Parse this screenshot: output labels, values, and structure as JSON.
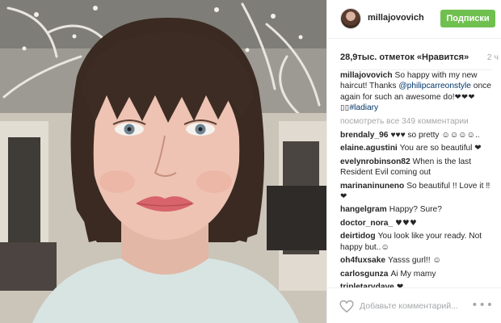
{
  "post": {
    "username": "millajovovich",
    "follow_label": "Подписки",
    "likes": "28,9тыс. отметок «Нравится»",
    "time": "2 ч",
    "caption": {
      "user": "millajovovich",
      "text_1": "So happy with my new haircut! Thanks",
      "mention": "@philipcarreonstyle",
      "text_2": "once again for such an awesome do!",
      "hearts": "❤❤❤",
      "tag_prefix": "▯▯",
      "hashtag": "#ladiary"
    },
    "view_all": "посмотреть все 349 комментарии",
    "comments": [
      {
        "user": "brendaly_96",
        "text": "♥♥♥ so pretty ☺☺☺☺.."
      },
      {
        "user": "elaine.agustini",
        "text": "You are so beautiful ❤"
      },
      {
        "user": "evelynrobinson82",
        "text": "When is the last Resident Evil coming out"
      },
      {
        "user": "marinaninuneno",
        "text": "So beautiful !! Love it ‼ ❤"
      },
      {
        "user": "hangelgram",
        "text": "Happy? Sure?"
      },
      {
        "user": "doctor_nora_",
        "text": "♥♥♥"
      },
      {
        "user": "deirtidog",
        "text": "You look like your ready. Not happy but..☺"
      },
      {
        "user": "oh4fuxsake",
        "text": "Yasss gurl!! ☺"
      },
      {
        "user": "carlosgunza",
        "text": "Ai My mamy"
      },
      {
        "user": "tripletarvdave",
        "text": "❤"
      }
    ],
    "comment_placeholder": "Добавьте комментарий...",
    "more_icon": "•••"
  },
  "icons": {
    "like": "heart-outline-icon",
    "more": "more-options-icon"
  },
  "colors": {
    "follow_button": "#70c050",
    "link": "#003569",
    "muted": "#a5a7aa"
  }
}
